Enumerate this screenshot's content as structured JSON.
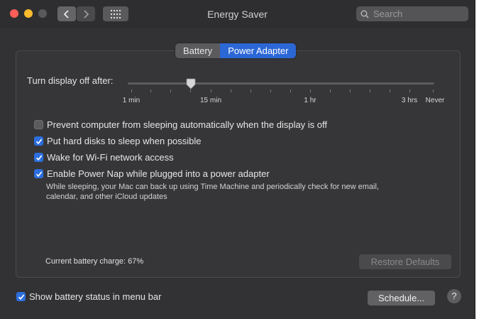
{
  "window": {
    "title": "Energy Saver",
    "search_placeholder": "Search"
  },
  "tabs": [
    {
      "label": "Battery",
      "selected": false
    },
    {
      "label": "Power Adapter",
      "selected": true
    }
  ],
  "display_sleep": {
    "label": "Turn display off after:",
    "value": "10 min",
    "tick_labels": [
      "1 min",
      "15 min",
      "1 hr",
      "3 hrs",
      "Never"
    ]
  },
  "options": [
    {
      "label": "Prevent computer from sleeping automatically when the display is off",
      "checked": false
    },
    {
      "label": "Put hard disks to sleep when possible",
      "checked": true
    },
    {
      "label": "Wake for Wi-Fi network access",
      "checked": true
    },
    {
      "label": "Enable Power Nap while plugged into a power adapter",
      "checked": true
    }
  ],
  "power_nap_note_line1": "While sleeping, your Mac can back up using Time Machine and periodically check for new email,",
  "power_nap_note_line2": "calendar, and other iCloud updates",
  "battery_charge": "Current battery charge: 67%",
  "restore_defaults": "Restore Defaults",
  "show_battery_status": {
    "label": "Show battery status in menu bar",
    "checked": true
  },
  "schedule_button": "Schedule...",
  "help_button": "?",
  "colors": {
    "accent": "#2c67d6",
    "close": "#ff5f57",
    "minimize": "#febc2e"
  }
}
